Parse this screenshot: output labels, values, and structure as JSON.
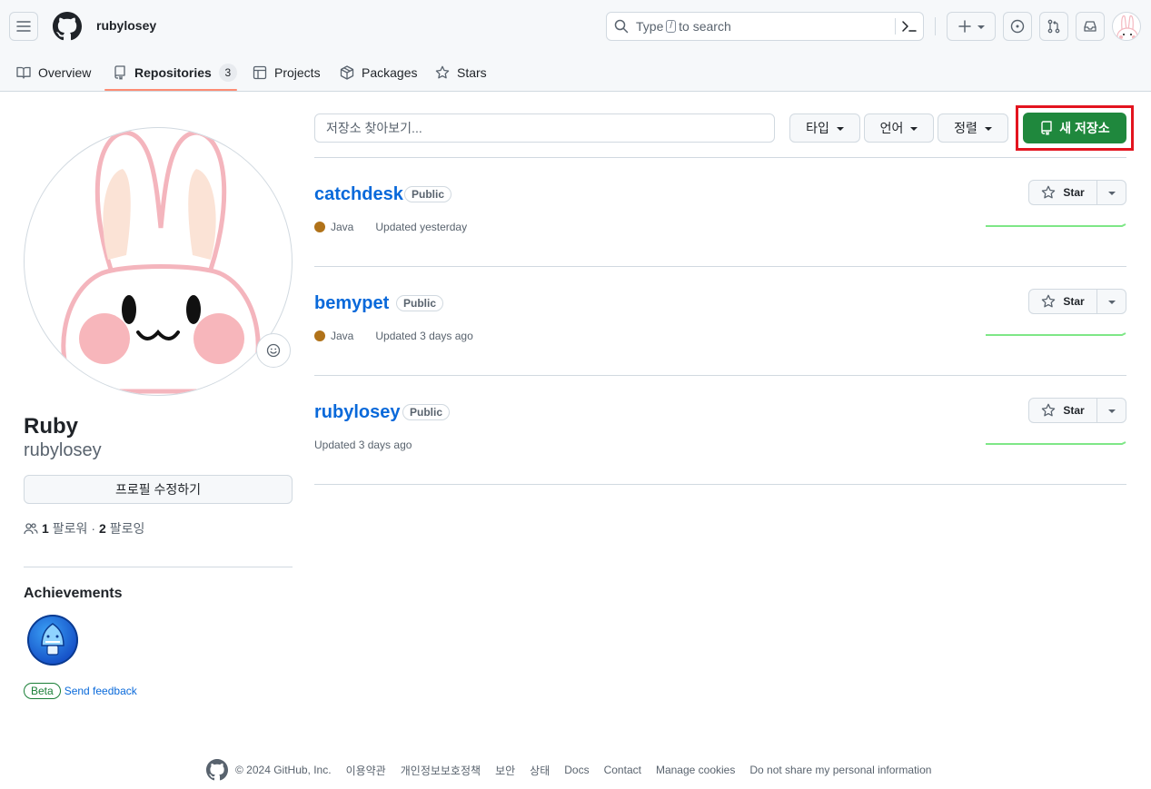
{
  "header": {
    "username": "rubylosey",
    "search": {
      "text_before": "Type",
      "key": "/",
      "text_after": "to search"
    },
    "icons": [
      "hamburger-icon",
      "github-logo",
      "search-icon",
      "command-palette-icon",
      "plus-icon",
      "issues-icon",
      "pull-requests-icon",
      "inbox-icon"
    ]
  },
  "tabs": [
    {
      "label": "Overview",
      "icon": "book-icon"
    },
    {
      "label": "Repositories",
      "icon": "repo-icon",
      "count": "3",
      "active": true
    },
    {
      "label": "Projects",
      "icon": "table-icon"
    },
    {
      "label": "Packages",
      "icon": "package-icon"
    },
    {
      "label": "Stars",
      "icon": "star-icon"
    }
  ],
  "profile": {
    "name": "Ruby",
    "login": "rubylosey",
    "edit_label": "프로필 수정하기",
    "followers_count": "1",
    "followers_label": "팔로워",
    "following_count": "2",
    "following_label": "팔로잉",
    "dot": "·",
    "achievements_title": "Achievements",
    "beta_label": "Beta",
    "feedback_label": "Send feedback"
  },
  "repo_list": {
    "filter_placeholder": "저장소 찾아보기...",
    "type_label": "타입",
    "language_label": "언어",
    "sort_label": "정렬",
    "new_label": "새 저장소",
    "star_label": "Star",
    "public_label": "Public",
    "repos": [
      {
        "name": "catchdesk",
        "language": "Java",
        "language_color": "#b07219",
        "updated": "Updated yesterday"
      },
      {
        "name": "bemypet",
        "language": "Java",
        "language_color": "#b07219",
        "updated": "Updated 3 days ago"
      },
      {
        "name": "rubylosey",
        "language": "",
        "language_color": "",
        "updated": "Updated 3 days ago"
      }
    ]
  },
  "footer": {
    "copyright": "© 2024 GitHub, Inc.",
    "links": [
      "이용약관",
      "개인정보보호정책",
      "보안",
      "상태",
      "Docs",
      "Contact",
      "Manage cookies",
      "Do not share my personal information"
    ]
  },
  "colors": {
    "accent_green": "#1f883d",
    "link_blue": "#0969da",
    "tab_underline": "#fd8c73",
    "highlight_red": "#e3141f",
    "sparkline_green": "#7ee787"
  }
}
